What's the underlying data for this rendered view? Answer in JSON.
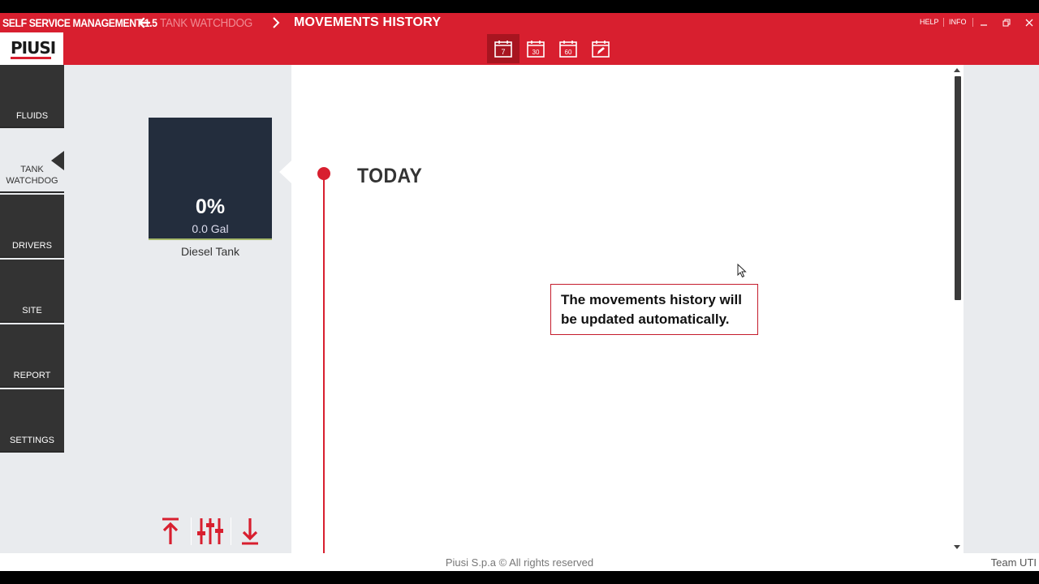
{
  "titlebar": {
    "app_name": "SELF SERVICE MANAGEMENT 1.5",
    "breadcrumb_previous": "TANK WATCHDOG",
    "breadcrumb_current": "MOVEMENTS HISTORY",
    "help_label": "HELP",
    "info_label": "INFO"
  },
  "logo": {
    "text": "PIUSI"
  },
  "toolbar": {
    "calendar_buttons": [
      {
        "label": "7"
      },
      {
        "label": "30"
      },
      {
        "label": "60"
      },
      {
        "label": "custom"
      }
    ]
  },
  "sidebar": {
    "items": [
      {
        "label": "FLUIDS"
      },
      {
        "label": "TANK\nWATCHDOG"
      },
      {
        "label": "DRIVERS"
      },
      {
        "label": "SITE"
      },
      {
        "label": "REPORT"
      },
      {
        "label": "SETTINGS"
      }
    ]
  },
  "tank": {
    "level_percent": "0%",
    "volume": "0.0 Gal",
    "name": "Diesel Tank",
    "fill_fraction": 0
  },
  "timeline": {
    "heading": "TODAY"
  },
  "notice": {
    "line1": "The movements history will",
    "line2": "be updated automatically."
  },
  "footer": {
    "copyright": "Piusi S.p.a © All rights reserved",
    "team": "Team UTI"
  },
  "colors": {
    "brand_red": "#d81f2f",
    "sidebar_dark": "#333333",
    "tank_tile": "#232d3d"
  }
}
